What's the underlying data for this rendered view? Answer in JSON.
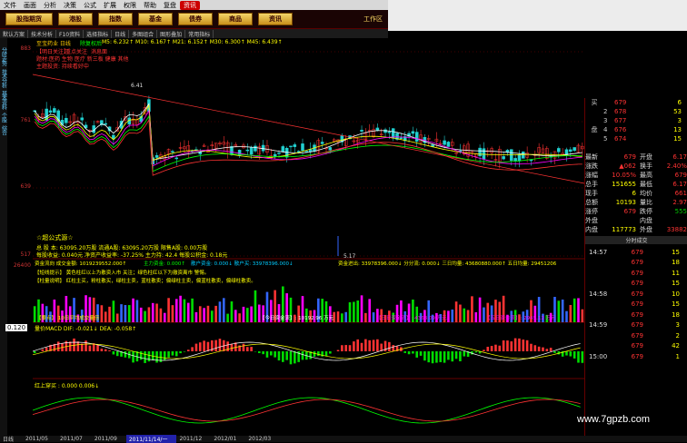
{
  "menubar": {
    "items": [
      "文件",
      "画面",
      "分析",
      "决策",
      "公式",
      "扩展",
      "权限",
      "帮助",
      "复盘",
      "资讯"
    ],
    "highlight": "资讯",
    "hl_index": 9
  },
  "buttons": {
    "items": [
      "股指期货",
      "港股",
      "指数",
      "基金",
      "债券",
      "商品",
      "资讯"
    ],
    "workspace": "工作区"
  },
  "toolbar": {
    "items": [
      "默认方案",
      "技术分析",
      "F10资料",
      "选择指标",
      "日线",
      "多图组合",
      "图形叠加",
      "常用指标"
    ]
  },
  "sidebar": {
    "items": [
      "分时走势",
      "技术分析",
      "基本资料",
      "个股",
      "综合"
    ]
  },
  "main_chart": {
    "title": "至宝药业 日线",
    "subtitle": "除复权后",
    "ma_line": "M5: 6.232↑ M10: 6.167↑ M21: 6.152↑ M30: 6.300↑ M45: 6.439↑",
    "tags": [
      "【明日关注】",
      "重点关注",
      "消息面",
      "题材:医药 生物 医疗 新三板 健康 其他"
    ],
    "theme": "主题投资: 持续看好中",
    "peak_label": "6.41",
    "low_label": "5.17",
    "formula_name": "☆超公式源☆",
    "stats1": "总 股 本: 63095.20万股 流通A股: 63095.20万股 限售A股: 0.00万股",
    "stats2": "每股收益: 0.040元 净资产收益率: -37.25% 主力持: 42.4 每股公积金: 0.18元",
    "y_labels": [
      "883",
      "761",
      "639",
      "517"
    ]
  },
  "volume_panel": {
    "label": "资金流向 成交金额: 1019239552.000↑",
    "green_label": "主力资金: 0.000↑",
    "label2": "散户资金: 0.000↓ 散户买: 33978396.000↓",
    "right_label": "资金进出: 33978396.000↓ 分分流: 0.000↓ 三日均量: 43680880.000↑ 五日均量: 29451206",
    "line2": "【短线提示】 黄色柱红以上为散资入市 关注；绿色柱红以下为撤资离市 警惕。",
    "line3": "【柱量说明】 红柱主买，粉柱散买，绿柱主卖，蓝柱散卖；偏绿柱主卖，偏蓝柱散卖，偏绿柱散卖。",
    "note_left": "【要点】 10日平均成交量倍",
    "note_mid": "【今日资金流】: 10192.96 万元",
    "note_mid2": "【三日资金流】: 4368.09 万元",
    "note_right": "【五日资金流】: 2945.12 万元",
    "y_label": "26400"
  },
  "macd_panel": {
    "value_badge": "0.120",
    "label": "量价MACD DIF: -0.021↓ DEA: -0.058↑"
  },
  "bottom_panel": {
    "label": "红上穿买 : 0.000 0.006↓"
  },
  "quote": {
    "orderbook": [
      {
        "side": "买",
        "lvl": "",
        "price": "679",
        "vol": "6"
      },
      {
        "side": "",
        "lvl": "2",
        "price": "678",
        "vol": "53"
      },
      {
        "side": "",
        "lvl": "3",
        "price": "677",
        "vol": "3"
      },
      {
        "side": "盘",
        "lvl": "4",
        "price": "676",
        "vol": "13"
      },
      {
        "side": "",
        "lvl": "5",
        "price": "674",
        "vol": "15"
      }
    ],
    "stats": [
      {
        "k": "最新",
        "v": "679",
        "k2": "开盘",
        "v2": "6.17"
      },
      {
        "k": "涨跌",
        "v": "▲062",
        "k2": "换手",
        "v2": "2.40%"
      },
      {
        "k": "涨幅",
        "v": "10.05%",
        "k2": "最高",
        "v2": "679"
      },
      {
        "k": "总手",
        "v": "151655",
        "k2": "最低",
        "v2": "6.17"
      },
      {
        "k": "现手",
        "v": "6",
        "k2": "均价",
        "v2": "661"
      },
      {
        "k": "总额",
        "v": "10193",
        "k2": "量比",
        "v2": "2.97"
      },
      {
        "k": "涨停",
        "v": "679",
        "k2": "跌停",
        "v2": "555"
      },
      {
        "k": "外盘",
        "v": "",
        "k2": "内盘",
        "v2": ""
      },
      {
        "k": "内盘",
        "v": "117773",
        "k2": "外盘",
        "v2": "33882"
      }
    ],
    "ticks_header": "分时成交",
    "ticks": [
      {
        "t": "14:57",
        "p": "679",
        "v": "15"
      },
      {
        "t": "",
        "p": "679",
        "v": "18"
      },
      {
        "t": "",
        "p": "679",
        "v": "11"
      },
      {
        "t": "",
        "p": "679",
        "v": "15"
      },
      {
        "t": "14:58",
        "p": "679",
        "v": "10"
      },
      {
        "t": "",
        "p": "679",
        "v": "15"
      },
      {
        "t": "",
        "p": "679",
        "v": "18"
      },
      {
        "t": "14:59",
        "p": "679",
        "v": "3"
      },
      {
        "t": "",
        "p": "679",
        "v": "2"
      },
      {
        "t": "",
        "p": "679",
        "v": "42"
      },
      {
        "t": "15:00",
        "p": "679",
        "v": "1"
      }
    ]
  },
  "bottom_bar": {
    "items": [
      "日线",
      "2011/05",
      "2011/07",
      "2011/09",
      "2011/11/14/一",
      "2011/12",
      "2012/01",
      "2012/03"
    ],
    "selected": "2011/11/14/一"
  },
  "watermark": "www.7gpzb.com",
  "colors": {
    "up": "#ff3333",
    "down": "#22d0d0",
    "ma5": "#ffffff",
    "ma10": "#ffff00",
    "ma20": "#ff00ff",
    "ma30": "#00ff00",
    "ma60": "#ff3333"
  }
}
